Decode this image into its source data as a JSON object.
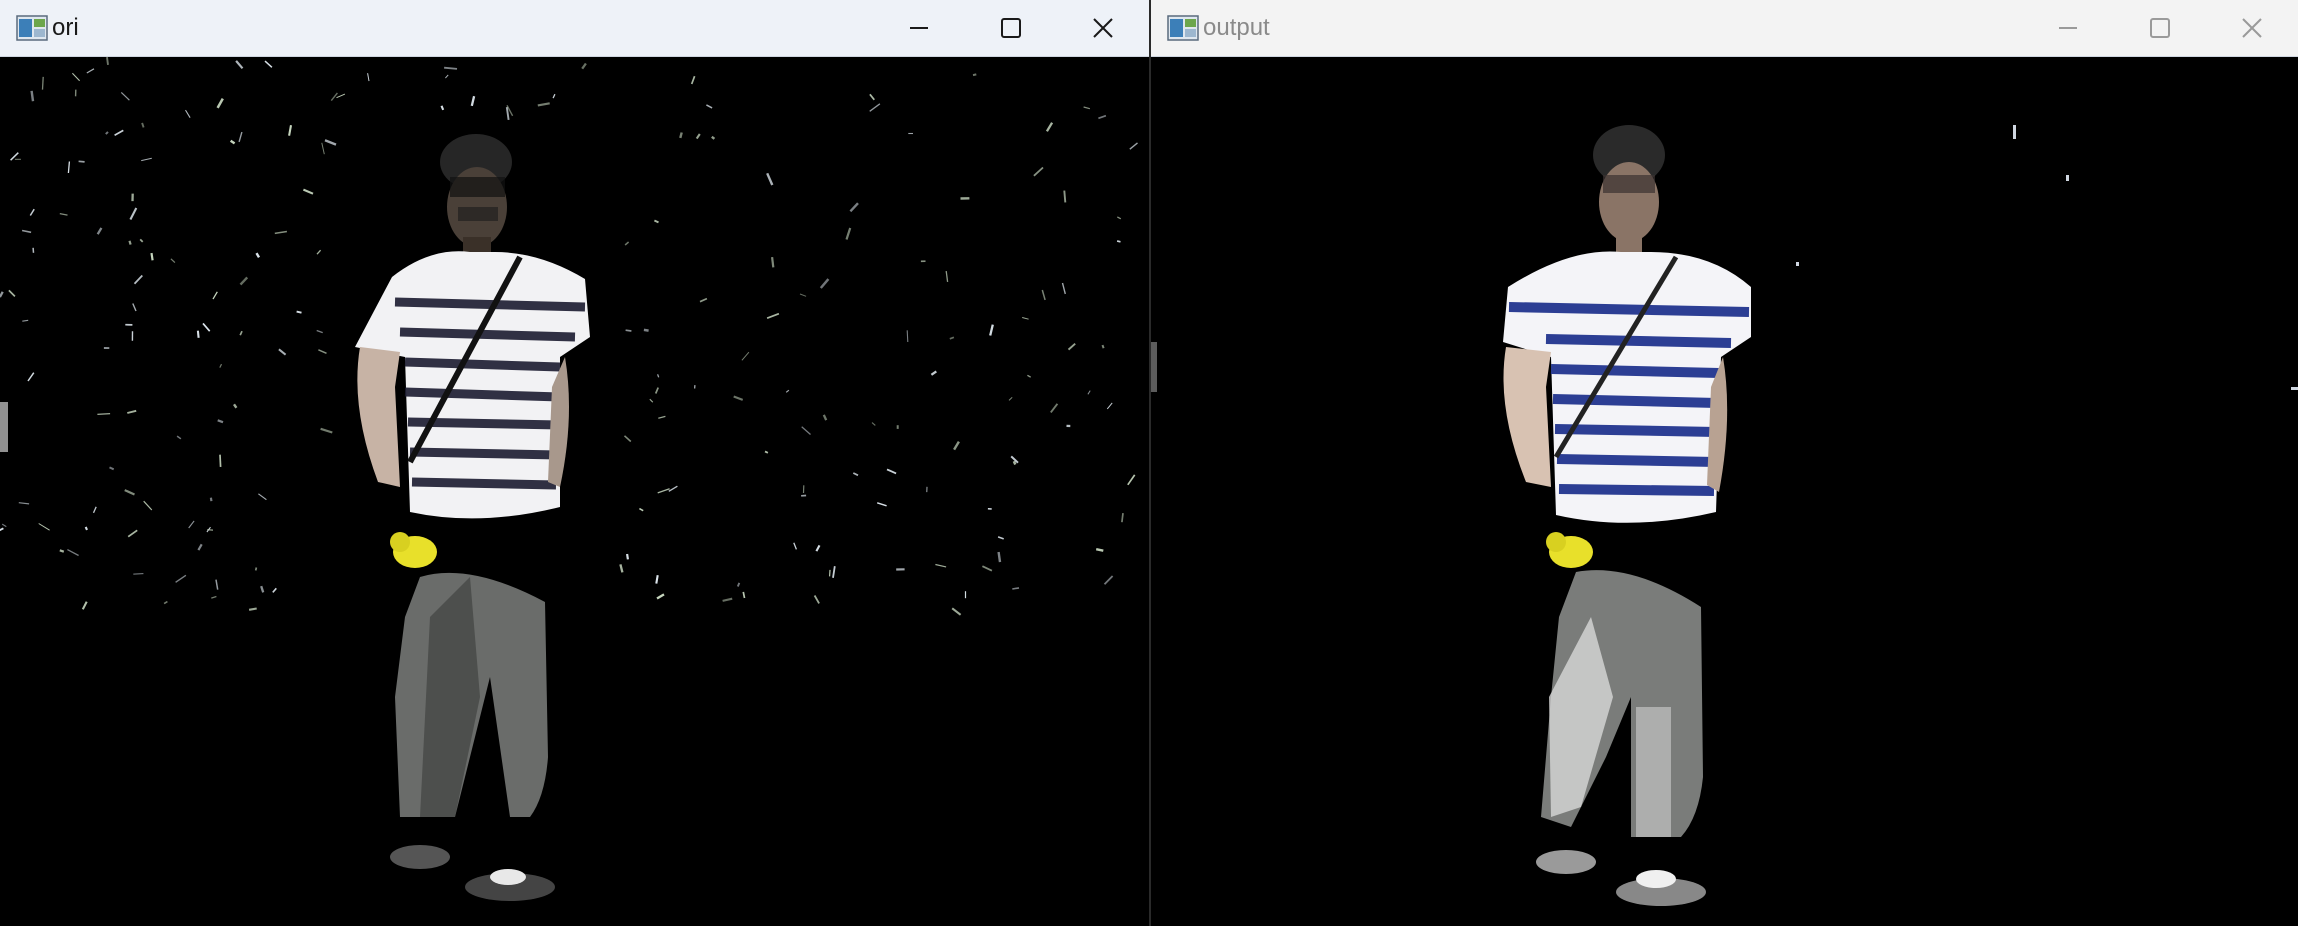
{
  "windows": [
    {
      "title": "ori",
      "state": "active",
      "icon": "opencv-highgui-icon",
      "buttons": [
        "minimize-icon",
        "maximize-icon",
        "close-icon"
      ]
    },
    {
      "title": "output",
      "state": "inactive",
      "icon": "opencv-highgui-icon",
      "buttons": [
        "minimize-icon",
        "maximize-icon",
        "close-icon"
      ]
    }
  ],
  "colors": {
    "titlebar_active": "#eef2f8",
    "titlebar_inactive": "#f3f3f3",
    "background": "#000000",
    "shirt_stripe": "#2c3e94",
    "object_yellow": "#e8e02a"
  }
}
